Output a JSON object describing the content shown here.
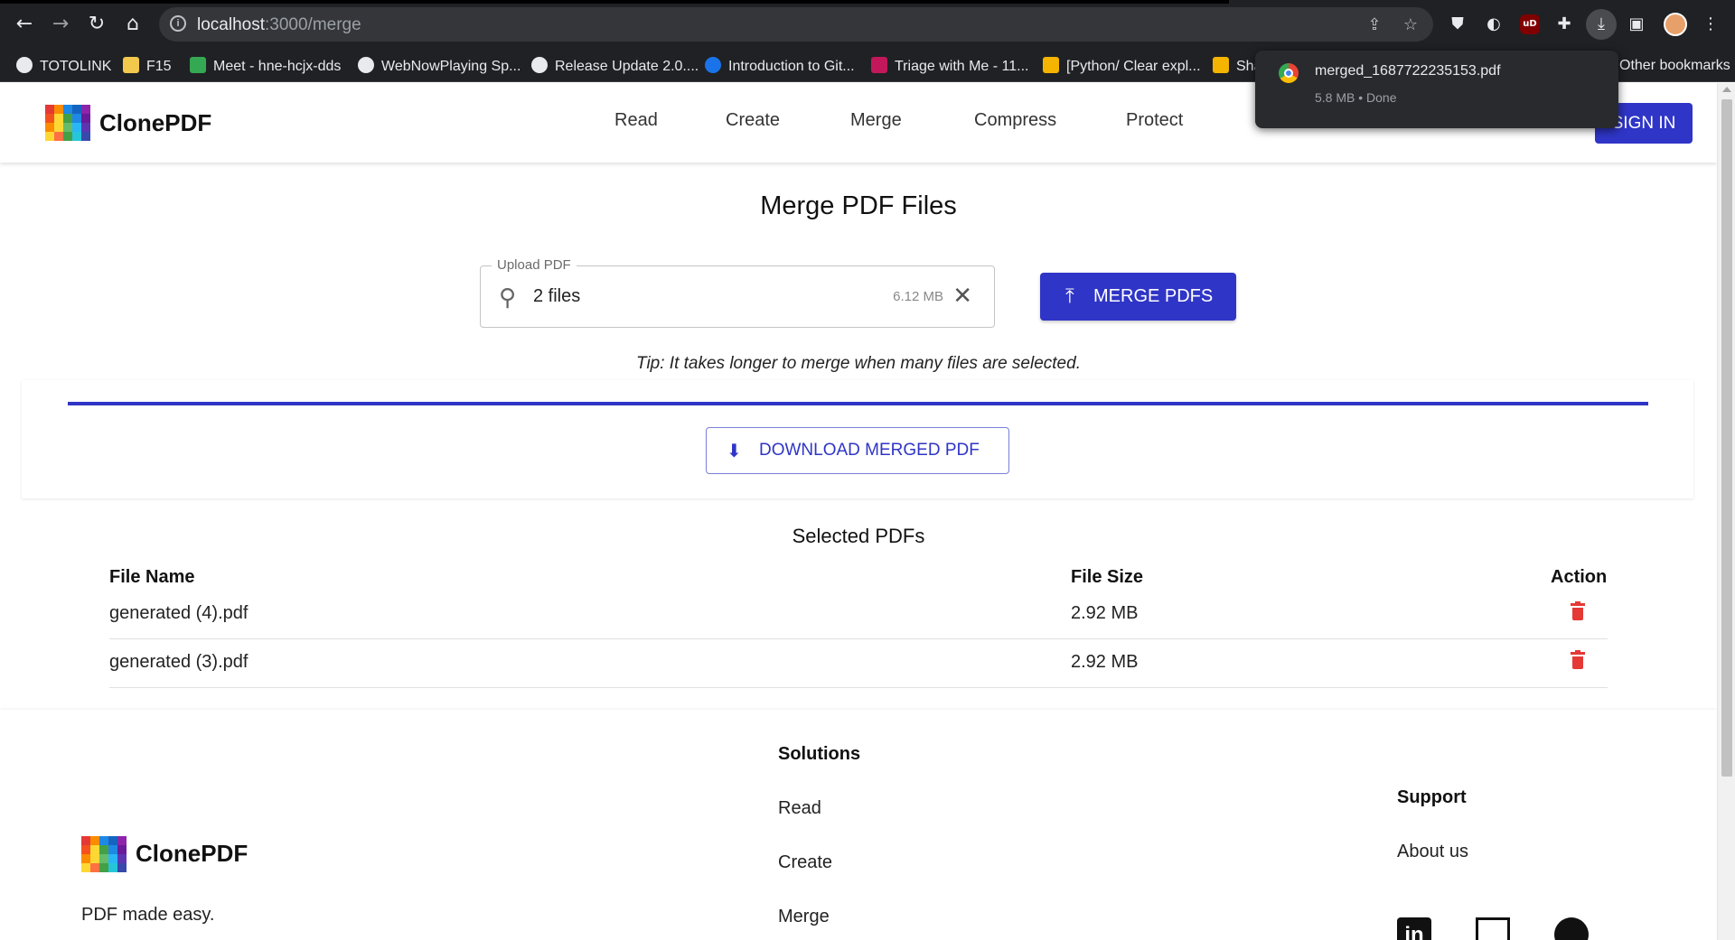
{
  "browser": {
    "url_host": "localhost",
    "url_path": ":3000/merge",
    "bookmarks": [
      "TOTOLINK",
      "F15",
      "Meet - hne-hcjx-dds",
      "WebNowPlaying Sp...",
      "Release Update 2.0....",
      "Introduction to Git...",
      "Triage with Me - 11...",
      "[Python/ Clear expl...",
      "Sha"
    ],
    "other_bookmarks": "Other bookmarks",
    "download": {
      "filename": "merged_1687722235153.pdf",
      "meta": "5.8 MB • Done"
    },
    "ublock_label": "uD"
  },
  "app": {
    "brand": "ClonePDF",
    "nav": [
      "Read",
      "Create",
      "Merge",
      "Compress",
      "Protect"
    ],
    "sign_in": "SIGN IN",
    "accent": "#2f35c6"
  },
  "merge": {
    "title": "Merge PDF Files",
    "upload_label": "Upload PDF",
    "upload_value": "2 files",
    "upload_size": "6.12 MB",
    "merge_button": "MERGE PDFS",
    "tip": "Tip: It takes longer to merge when many files are selected.",
    "progress_percent": 100,
    "download_button": "DOWNLOAD MERGED PDF"
  },
  "selected": {
    "title": "Selected PDFs",
    "columns": [
      "File Name",
      "File Size",
      "Action"
    ],
    "rows": [
      {
        "name": "generated (4).pdf",
        "size": "2.92 MB"
      },
      {
        "name": "generated (3).pdf",
        "size": "2.92 MB"
      }
    ]
  },
  "footer": {
    "brand": "ClonePDF",
    "tagline": "PDF made easy.",
    "solutions_title": "Solutions",
    "solutions": [
      "Read",
      "Create",
      "Merge"
    ],
    "support_title": "Support",
    "support": [
      "About us"
    ],
    "linkedin_label": "in"
  },
  "icons": {
    "back": "back-arrow-icon",
    "forward": "forward-arrow-icon",
    "reload": "reload-icon",
    "home": "home-icon",
    "upload_clip": "paperclip-icon",
    "clear": "close-icon",
    "merge": "merge-icon",
    "download": "download-icon",
    "delete": "trash-icon"
  }
}
